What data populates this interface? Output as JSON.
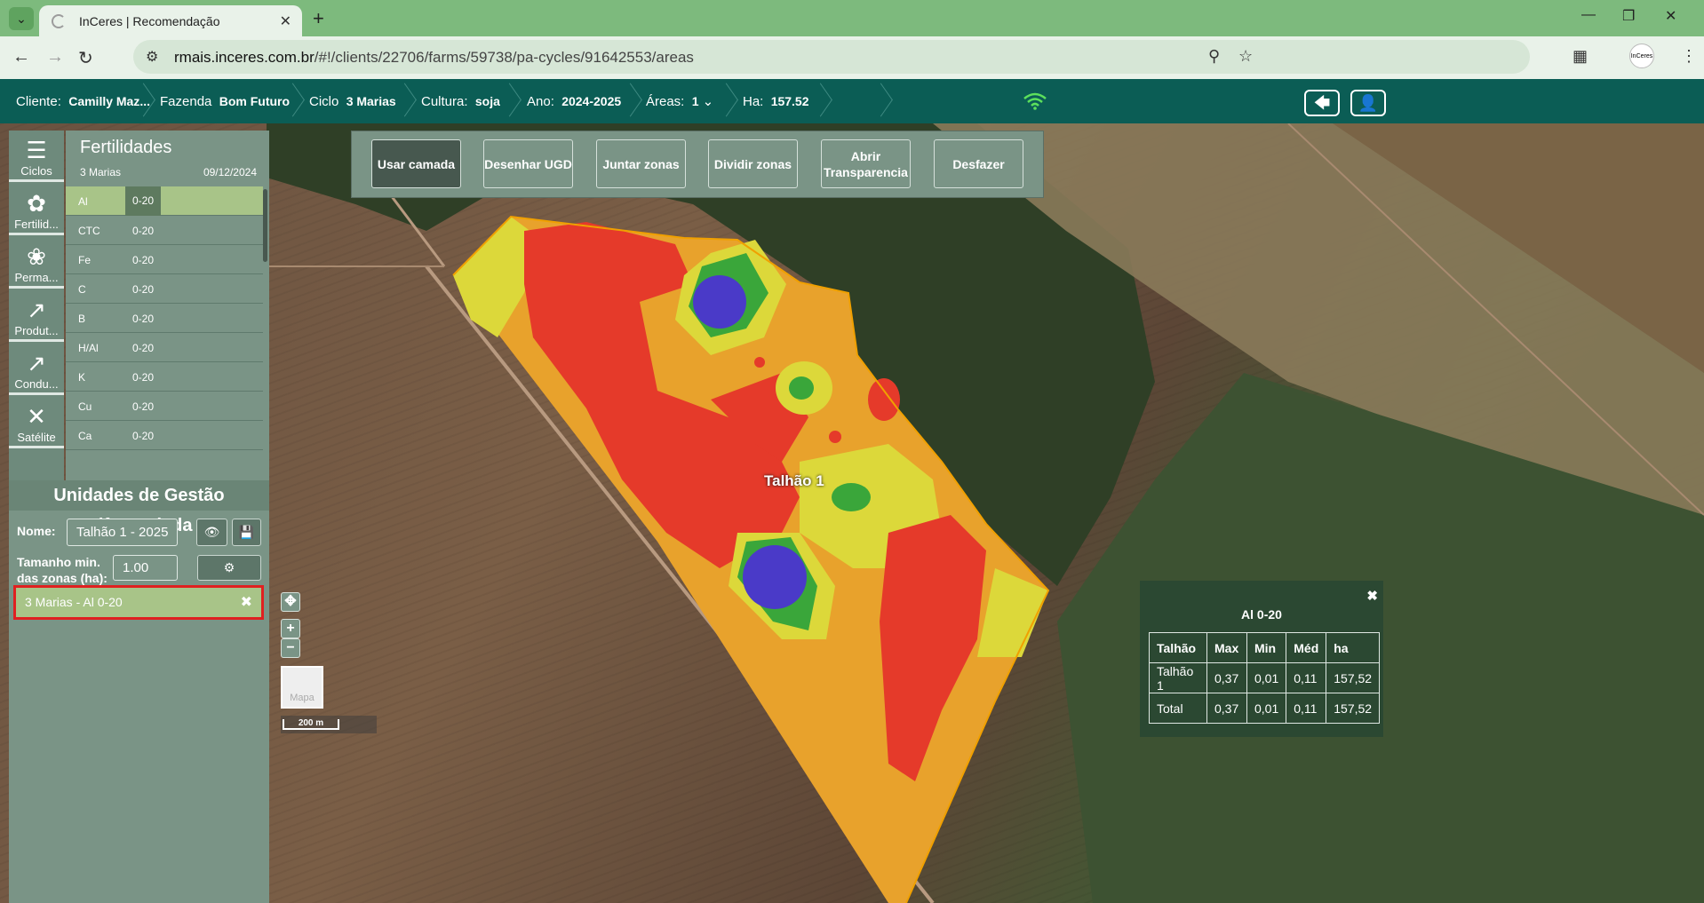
{
  "browser": {
    "tab_title": "InCeres | Recomendação",
    "url_domain": "rmais.inceres.com.br",
    "url_path": "/#!/clients/22706/farms/59738/pa-cycles/91642553/areas",
    "profile_label": "InCeres"
  },
  "header": {
    "cliente_label": "Cliente:",
    "cliente_value": "Camilly Maz...",
    "fazenda_label": "Fazenda",
    "fazenda_value": "Bom Futuro",
    "ciclo_label": "Ciclo",
    "ciclo_value": "3 Marias",
    "cultura_label": "Cultura:",
    "cultura_value": "soja",
    "ano_label": "Ano:",
    "ano_value": "2024-2025",
    "areas_label": "Áreas:",
    "areas_value": "1",
    "ha_label": "Ha:",
    "ha_value": "157.52"
  },
  "sidebar": {
    "items": [
      {
        "label": "Ciclos",
        "icon": "list-icon"
      },
      {
        "label": "Fertilid...",
        "icon": "fertility-icon"
      },
      {
        "label": "Perma...",
        "icon": "plants-icon"
      },
      {
        "label": "Produt...",
        "icon": "chart-line-icon"
      },
      {
        "label": "Condu...",
        "icon": "chart-line-icon"
      },
      {
        "label": "Satélite",
        "icon": "satellite-icon"
      }
    ]
  },
  "fertilidades": {
    "title": "Fertilidades",
    "ciclo": "3 Marias",
    "date": "09/12/2024",
    "rows": [
      {
        "name": "Al",
        "depth": "0-20"
      },
      {
        "name": "CTC",
        "depth": "0-20"
      },
      {
        "name": "Fe",
        "depth": "0-20"
      },
      {
        "name": "C",
        "depth": "0-20"
      },
      {
        "name": "B",
        "depth": "0-20"
      },
      {
        "name": "H/Al",
        "depth": "0-20"
      },
      {
        "name": "K",
        "depth": "0-20"
      },
      {
        "name": "Cu",
        "depth": "0-20"
      },
      {
        "name": "Ca",
        "depth": "0-20"
      }
    ]
  },
  "toolbar": {
    "usar_camada": "Usar camada",
    "desenhar_ugd": "Desenhar UGD",
    "juntar_zonas": "Juntar zonas",
    "dividir_zonas": "Dividir zonas",
    "abrir_transparencia": "Abrir Transparencia",
    "desfazer": "Desfazer"
  },
  "ugd": {
    "title": "Unidades de Gestão Diferenciada",
    "nome_label": "Nome:",
    "nome_value": "Talhão 1 - 2025",
    "tamanho_label": "Tamanho min. das zonas (ha):",
    "tamanho_value": "1.00",
    "selected_item": "3 Marias - Al 0-20"
  },
  "map": {
    "field_label": "Talhão 1",
    "map_type_label": "Mapa",
    "scale_label": "200 m",
    "zone_colors": {
      "red": "#e53a2a",
      "orange": "#e8a22c",
      "yellow": "#dcd83a",
      "green": "#3aa63a",
      "blue": "#4a3ac8"
    }
  },
  "legend": {
    "title": "Al 0-20",
    "columns": [
      "Talhão",
      "Max",
      "Min",
      "Méd",
      "ha"
    ],
    "rows": [
      [
        "Talhão 1",
        "0,37",
        "0,01",
        "0,11",
        "157,52"
      ],
      [
        "Total",
        "0,37",
        "0,01",
        "0,11",
        "157,52"
      ]
    ]
  },
  "colors": {
    "chrome": "#7dba7d",
    "header": "#0b5d55",
    "panel": "#7a9486",
    "selected": "#a8c488",
    "highlight_border": "#e02020"
  }
}
